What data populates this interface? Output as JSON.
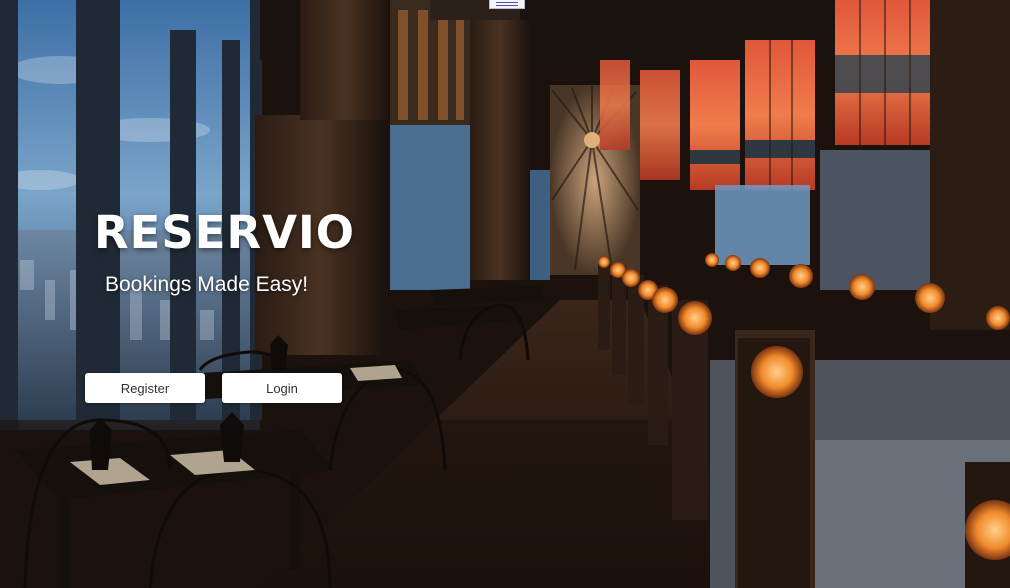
{
  "brand": {
    "name": "RESERVIO",
    "tagline": "Bookings Made Easy!"
  },
  "actions": {
    "register_label": "Register",
    "login_label": "Login"
  },
  "nav": {
    "menu_icon": "hamburger-menu-icon"
  },
  "colors": {
    "button_bg": "#ffffff",
    "button_text": "#2e3136",
    "brand_text": "#ffffff"
  }
}
